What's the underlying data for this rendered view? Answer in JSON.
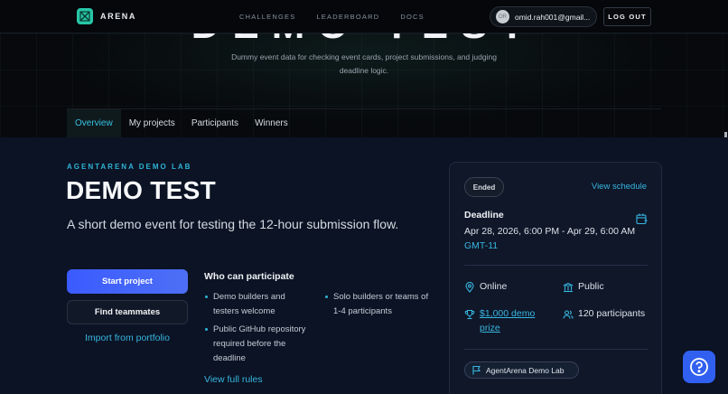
{
  "nav": {
    "brand": "ARENA",
    "links": [
      "CHALLENGES",
      "LEADERBOARD",
      "DOCS"
    ],
    "account_email": "omid.rah001@gmail...",
    "avatar_initials": "OR",
    "logout_label": "LOG OUT"
  },
  "hero": {
    "big_title": "DEMO TEST",
    "description": "Dummy event data for checking event cards, project submissions, and judging deadline logic.",
    "tabs": [
      "Overview",
      "My projects",
      "Participants",
      "Winners"
    ],
    "active_tab": "Overview"
  },
  "event": {
    "eyebrow": "AGENTARENA DEMO LAB",
    "title": "DEMO TEST",
    "subtitle": "A short demo event for testing the 12-hour submission flow.",
    "start_label": "Start project",
    "find_label": "Find teammates",
    "import_label": "Import from portfolio",
    "who_title": "Who can participate",
    "who_items": [
      "Demo builders and testers welcome",
      "Public GitHub repository required before the deadline",
      "Solo builders or teams of 1-4 participants"
    ],
    "rules_label": "View full rules"
  },
  "card": {
    "status": "Ended",
    "schedule_label": "View schedule",
    "deadline_label": "Deadline",
    "deadline_text": "Apr 28, 2026, 6:00 PM - Apr 29, 6:00 AM",
    "timezone": "GMT-11",
    "location": "Online",
    "visibility": "Public",
    "prize": "$1,000 demo prize",
    "participants": "120 participants",
    "organizer": "AgentArena Demo Lab"
  },
  "colors": {
    "accent": "#38b6e0",
    "primary_button": "#3b5bff",
    "brand_mark": "#27c7a8",
    "background": "#0b1324"
  },
  "icons": [
    "arena-logo-icon",
    "calendar-plus-icon",
    "map-pin-icon",
    "building-icon",
    "trophy-icon",
    "users-icon",
    "flag-icon",
    "help-icon"
  ]
}
